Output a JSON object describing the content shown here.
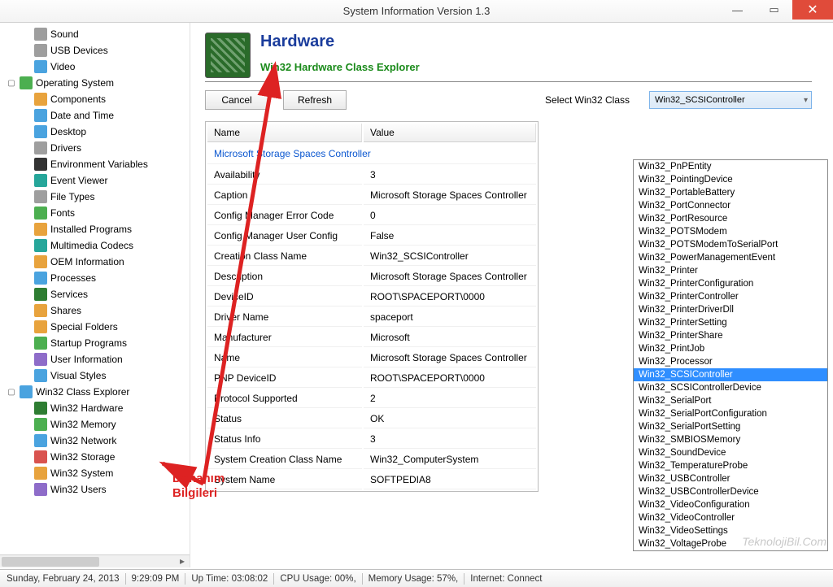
{
  "window": {
    "title": "System Information Version 1.3"
  },
  "sidebar": {
    "items": [
      {
        "label": "Sound",
        "indent": 1,
        "ic": "ic-gray"
      },
      {
        "label": "USB Devices",
        "indent": 1,
        "ic": "ic-gray"
      },
      {
        "label": "Video",
        "indent": 1,
        "ic": "ic-blue"
      }
    ],
    "group1": {
      "label": "Operating System",
      "ic": "ic-green"
    },
    "g1items": [
      {
        "label": "Components",
        "ic": "ic-orange"
      },
      {
        "label": "Date and Time",
        "ic": "ic-blue"
      },
      {
        "label": "Desktop",
        "ic": "ic-blue"
      },
      {
        "label": "Drivers",
        "ic": "ic-gray"
      },
      {
        "label": "Environment Variables",
        "ic": "ic-black"
      },
      {
        "label": "Event Viewer",
        "ic": "ic-teal"
      },
      {
        "label": "File Types",
        "ic": "ic-gray"
      },
      {
        "label": "Fonts",
        "ic": "ic-green"
      },
      {
        "label": "Installed Programs",
        "ic": "ic-orange"
      },
      {
        "label": "Multimedia Codecs",
        "ic": "ic-teal"
      },
      {
        "label": "OEM Information",
        "ic": "ic-orange"
      },
      {
        "label": "Processes",
        "ic": "ic-blue"
      },
      {
        "label": "Services",
        "ic": "ic-dgreen"
      },
      {
        "label": "Shares",
        "ic": "ic-orange"
      },
      {
        "label": "Special Folders",
        "ic": "ic-orange"
      },
      {
        "label": "Startup Programs",
        "ic": "ic-green"
      },
      {
        "label": "User Information",
        "ic": "ic-purple"
      },
      {
        "label": "Visual Styles",
        "ic": "ic-blue"
      }
    ],
    "group2": {
      "label": "Win32 Class Explorer",
      "ic": "ic-blue"
    },
    "g2items": [
      {
        "label": "Win32 Hardware",
        "ic": "ic-dgreen"
      },
      {
        "label": "Win32 Memory",
        "ic": "ic-green"
      },
      {
        "label": "Win32 Network",
        "ic": "ic-blue"
      },
      {
        "label": "Win32 Storage",
        "ic": "ic-red"
      },
      {
        "label": "Win32 System",
        "ic": "ic-orange"
      },
      {
        "label": "Win32 Users",
        "ic": "ic-purple"
      }
    ]
  },
  "header": {
    "title": "Hardware",
    "subtitle": "Win32 Hardware Class Explorer"
  },
  "toolbar": {
    "cancel": "Cancel",
    "refresh": "Refresh",
    "select_label": "Select Win32 Class",
    "selected": "Win32_SCSIController"
  },
  "table": {
    "col_name": "Name",
    "col_value": "Value",
    "group": "Microsoft Storage Spaces Controller",
    "rows": [
      {
        "n": "Availability",
        "v": "3"
      },
      {
        "n": "Caption",
        "v": "Microsoft Storage Spaces Controller"
      },
      {
        "n": "Config Manager Error Code",
        "v": "0"
      },
      {
        "n": "Config Manager User Config",
        "v": "False"
      },
      {
        "n": "Creation Class Name",
        "v": "Win32_SCSIController"
      },
      {
        "n": "Description",
        "v": "Microsoft Storage Spaces Controller"
      },
      {
        "n": "DeviceID",
        "v": "ROOT\\SPACEPORT\\0000"
      },
      {
        "n": "Driver Name",
        "v": "spaceport"
      },
      {
        "n": "Manufacturer",
        "v": "Microsoft"
      },
      {
        "n": "Name",
        "v": "Microsoft Storage Spaces Controller"
      },
      {
        "n": "PNP DeviceID",
        "v": "ROOT\\SPACEPORT\\0000"
      },
      {
        "n": "Protocol Supported",
        "v": "2"
      },
      {
        "n": "Status",
        "v": "OK"
      },
      {
        "n": "Status Info",
        "v": "3"
      },
      {
        "n": "System Creation Class Name",
        "v": "Win32_ComputerSystem"
      },
      {
        "n": "System Name",
        "v": "SOFTPEDIA8"
      }
    ]
  },
  "dropdown": {
    "selected": "Win32_SCSIController",
    "items": [
      "Win32_PnPEntity",
      "Win32_PointingDevice",
      "Win32_PortableBattery",
      "Win32_PortConnector",
      "Win32_PortResource",
      "Win32_POTSModem",
      "Win32_POTSModemToSerialPort",
      "Win32_PowerManagementEvent",
      "Win32_Printer",
      "Win32_PrinterConfiguration",
      "Win32_PrinterController",
      "Win32_PrinterDriverDll",
      "Win32_PrinterSetting",
      "Win32_PrinterShare",
      "Win32_PrintJob",
      "Win32_Processor",
      "Win32_SCSIController",
      "Win32_SCSIControllerDevice",
      "Win32_SerialPort",
      "Win32_SerialPortConfiguration",
      "Win32_SerialPortSetting",
      "Win32_SMBIOSMemory",
      "Win32_SoundDevice",
      "Win32_TemperatureProbe",
      "Win32_USBController",
      "Win32_USBControllerDevice",
      "Win32_VideoConfiguration",
      "Win32_VideoController",
      "Win32_VideoSettings",
      "Win32_VoltageProbe"
    ]
  },
  "status": {
    "date": "Sunday, February 24, 2013",
    "time": "9:29:09 PM",
    "uptime": "Up Time: 03:08:02",
    "cpu": "CPU Usage: 00%,",
    "mem": "Memory Usage: 57%,",
    "net": "Internet: Connect"
  },
  "annotation": {
    "l1": "Donanım",
    "l2": "Bilgileri"
  },
  "watermark": "TeknolojiBil.Com"
}
